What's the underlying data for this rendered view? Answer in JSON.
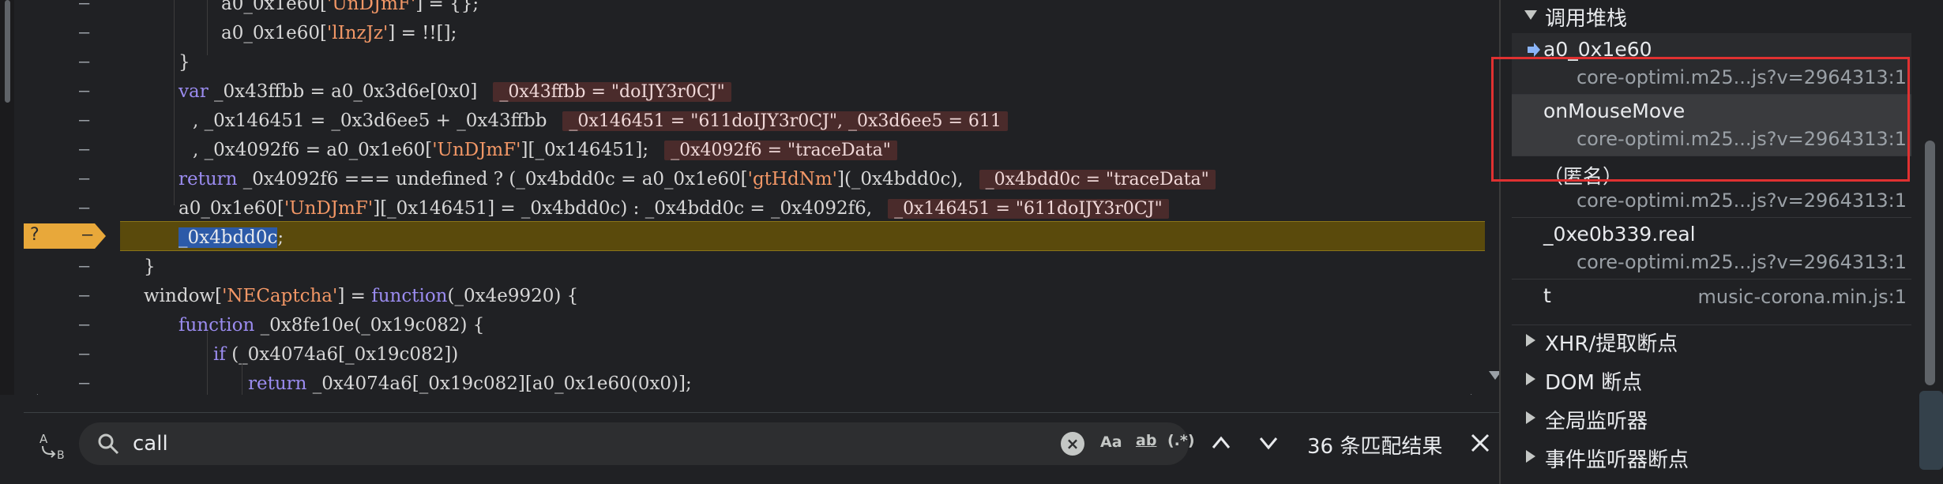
{
  "editor": {
    "lines": [
      {
        "mark": "–",
        "indent": 280,
        "html_parts": [
          [
            "id",
            "a0_0x1e60["
          ],
          [
            "str",
            "'UnDJmF'"
          ],
          [
            "id",
            "] = {};"
          ]
        ]
      },
      {
        "mark": "–",
        "indent": 280,
        "html_parts": [
          [
            "id",
            "a0_0x1e60["
          ],
          [
            "str",
            "'lInzJz'"
          ],
          [
            "id",
            "] = !![];"
          ]
        ]
      },
      {
        "mark": "–",
        "indent": 226,
        "html_parts": [
          [
            "id",
            "}"
          ]
        ]
      },
      {
        "mark": "–",
        "indent": 226,
        "html_parts": [
          [
            "kw",
            "var "
          ],
          [
            "id",
            "_0x43ffbb = a0_0x3d6e[0x0]"
          ]
        ],
        "inline": "_0x43ffbb = \"doIJY3r0CJ\""
      },
      {
        "mark": "–",
        "indent": 244,
        "html_parts": [
          [
            "id",
            ", _0x146451 = _0x3d6ee5 + _0x43ffbb"
          ]
        ],
        "inline": "_0x146451 = \"611doIJY3r0CJ\", _0x3d6ee5 = 611"
      },
      {
        "mark": "–",
        "indent": 244,
        "html_parts": [
          [
            "id",
            ", _0x4092f6 = a0_0x1e60["
          ],
          [
            "str",
            "'UnDJmF'"
          ],
          [
            "id",
            "][_0x146451];"
          ]
        ],
        "inline": "_0x4092f6 = \"traceData\""
      },
      {
        "mark": "–",
        "indent": 226,
        "html_parts": [
          [
            "kw",
            "return "
          ],
          [
            "id",
            "_0x4092f6 === undefined ? (_0x4bdd0c = a0_0x1e60["
          ],
          [
            "str",
            "'gtHdNm'"
          ],
          [
            "id",
            "](_0x4bdd0c),"
          ]
        ],
        "inline": "_0x4bdd0c = \"traceData\""
      },
      {
        "mark": "–",
        "indent": 226,
        "html_parts": [
          [
            "id",
            "a0_0x1e60["
          ],
          [
            "str",
            "'UnDJmF'"
          ],
          [
            "id",
            "][_0x146451] = _0x4bdd0c) : _0x4bdd0c = _0x4092f6,"
          ]
        ],
        "inline": "_0x146451 = \"611doIJY3r0CJ\""
      },
      {
        "mark": "–",
        "indent": 226,
        "selected": "_0x4bdd0c",
        "html_parts": [
          [
            "id",
            ";"
          ]
        ]
      },
      {
        "mark": "–",
        "indent": 182,
        "html_parts": [
          [
            "id",
            "}"
          ]
        ]
      },
      {
        "mark": "–",
        "indent": 182,
        "html_parts": [
          [
            "id",
            "window["
          ],
          [
            "str",
            "'NECaptcha'"
          ],
          [
            "id",
            "] = "
          ],
          [
            "kw",
            "function"
          ],
          [
            "id",
            "(_0x4e9920) {"
          ]
        ]
      },
      {
        "mark": "–",
        "indent": 226,
        "html_parts": [
          [
            "kw",
            "function "
          ],
          [
            "id",
            "_0x8fe10e(_0x19c082) {"
          ]
        ]
      },
      {
        "mark": "–",
        "indent": 270,
        "html_parts": [
          [
            "kw",
            "if "
          ],
          [
            "id",
            "(_0x4074a6[_0x19c082])"
          ]
        ]
      },
      {
        "mark": "–",
        "indent": 314,
        "html_parts": [
          [
            "kw",
            "return "
          ],
          [
            "id",
            "_0x4074a6[_0x19c082][a0_0x1e60(0x0)];"
          ]
        ]
      }
    ],
    "breakpoint_label": "?",
    "breakpoint_dash": "–"
  },
  "search": {
    "toggle_label": "A→B",
    "value": "call",
    "match_case": "Aa",
    "whole_word": "ab",
    "regex": "(.*)",
    "match_count": "36 条匹配结果"
  },
  "sidebar": {
    "call_stack_title": "调用堆栈",
    "frames": [
      {
        "name": "a0_0x1e60",
        "location": "core-optimi.m25...js?v=2964313:1",
        "current": true
      },
      {
        "name": "onMouseMove",
        "location": "core-optimi.m25...js?v=2964313:1"
      },
      {
        "name": "（匿名）",
        "location": "core-optimi.m25...js?v=2964313:1"
      },
      {
        "name": "_0xe0b339.real",
        "location": "core-optimi.m25...js?v=2964313:1"
      },
      {
        "name": "t",
        "location": "music-corona.min.js:1"
      }
    ],
    "sections": [
      {
        "title": "XHR/提取断点"
      },
      {
        "title": "DOM 断点"
      },
      {
        "title": "全局监听器"
      },
      {
        "title": "事件监听器断点"
      }
    ]
  },
  "colors": {
    "highlight_box": "#e03131",
    "paused_line": "#5a4a0c",
    "breakpoint": "#e8a83a"
  }
}
